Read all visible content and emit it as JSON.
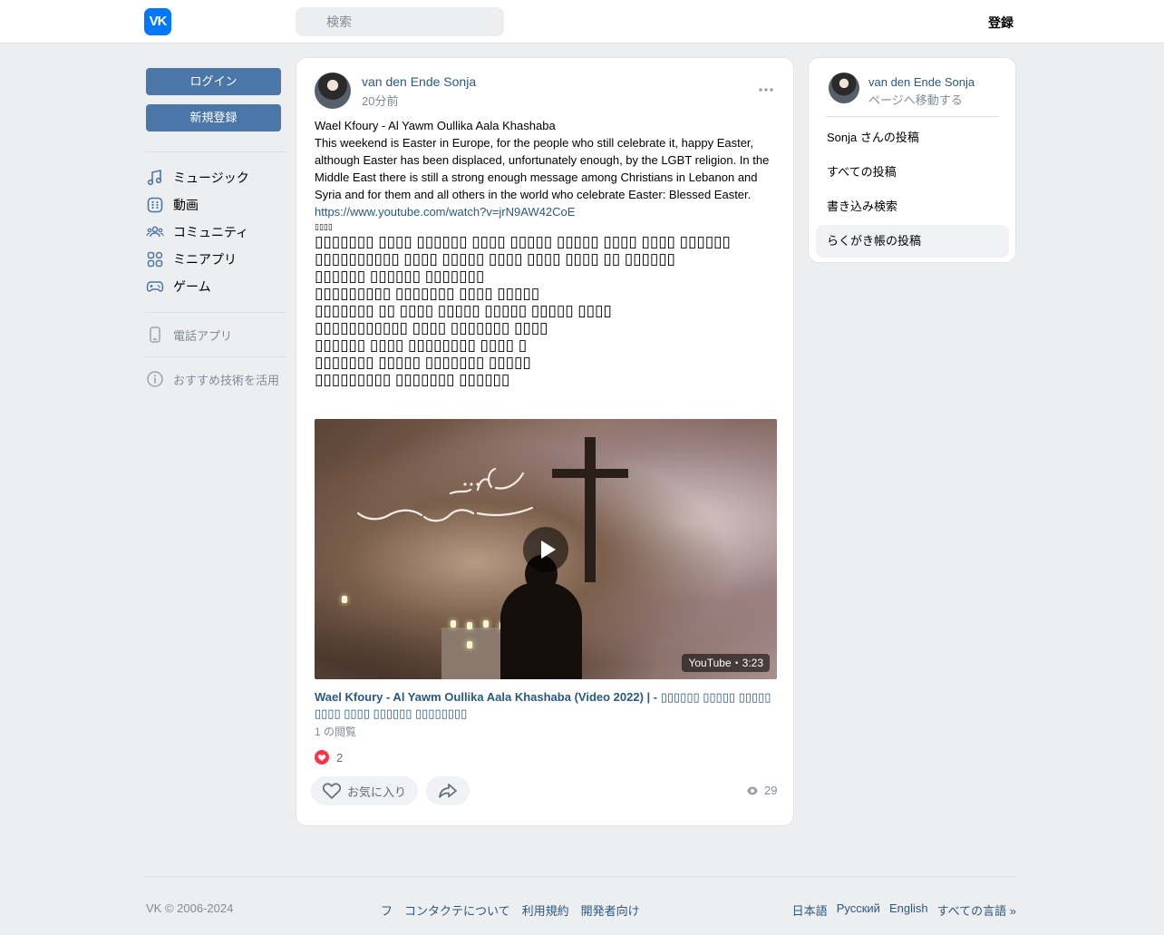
{
  "header": {
    "logo": "VK",
    "search_placeholder": "検索",
    "register_label": "登録"
  },
  "sidebar": {
    "login_label": "ログイン",
    "signup_label": "新規登録",
    "items": [
      {
        "label": "ミュージック",
        "icon": "music-icon"
      },
      {
        "label": "動画",
        "icon": "video-icon"
      },
      {
        "label": "コミュニティ",
        "icon": "community-icon"
      },
      {
        "label": "ミニアプリ",
        "icon": "mini-apps-icon"
      },
      {
        "label": "ゲーム",
        "icon": "gamepad-icon"
      }
    ],
    "phone_app_label": "電話アプリ",
    "recommended_label": "おすすめ技術を活用"
  },
  "post": {
    "author": "van den Ende Sonja",
    "time": "20分前",
    "text_title": "Wael Kfoury - Al Yawm Oullika Aala Khashaba",
    "text_body": "This weekend is Easter in Europe, for the people who still celebrate it, happy Easter, although Easter has been displaced, unfortunately enough, by the LGBT religion. In the Middle East there is still a strong enough message among Christians in Lebanon and Syria and for them and all others in the world who celebrate Easter: Blessed Easter.",
    "link": "https://www.youtube.com/watch?v=jrN9AW42CoE",
    "small_glyphs": "▯▯▯▯",
    "glyph_lines": [
      "▯▯▯▯▯▯▯ ▯▯▯▯ ▯▯▯▯▯▯ ▯▯▯▯ ▯▯▯▯▯ ▯▯▯▯▯ ▯▯▯▯ ▯▯▯▯ ▯▯▯▯▯▯",
      "▯▯▯▯▯▯▯▯▯▯ ▯▯▯▯ ▯▯▯▯▯ ▯▯▯▯ ▯▯▯▯ ▯▯▯▯ ▯▯ ▯▯▯▯▯▯",
      "▯▯▯▯▯▯ ▯▯▯▯▯▯ ▯▯▯▯▯▯▯",
      "▯▯▯▯▯▯▯▯▯ ▯▯▯▯▯▯▯ ▯▯▯▯ ▯▯▯▯▯",
      "▯▯▯▯▯▯▯ ▯▯ ▯▯▯▯ ▯▯▯▯▯ ▯▯▯▯▯ ▯▯▯▯▯ ▯▯▯▯",
      "▯▯▯▯▯▯▯▯▯▯▯ ▯▯▯▯ ▯▯▯▯▯▯▯ ▯▯▯▯",
      "▯▯▯▯▯▯ ▯▯▯▯ ▯▯▯▯▯▯▯▯ ▯▯▯▯ ▯",
      "▯▯▯▯▯▯▯ ▯▯▯▯▯ ▯▯▯▯▯▯▯ ▯▯▯▯▯",
      "▯▯▯▯▯▯▯▯▯ ▯▯▯▯▯▯▯ ▯▯▯▯▯▯"
    ],
    "video_duration": "YouTube・3:23",
    "video_title": "Wael Kfoury - Al Yawm Oullika Aala Khashaba (Video 2022) | - ▯▯▯▯▯▯ ▯▯▯▯▯ ▯▯▯▯▯ ▯▯▯▯ ▯▯▯▯ ▯▯▯▯▯▯ ▯▯▯▯▯▯▯▯",
    "video_views": "1 の閲覧",
    "likes_count": "2",
    "like_label": "お気に入り",
    "views_count": "29"
  },
  "right_panel": {
    "name": "van den Ende Sonja",
    "goto_label": "ページへ移動する",
    "items": [
      {
        "label": "Sonja さんの投稿",
        "active": false
      },
      {
        "label": "すべての投稿",
        "active": false
      },
      {
        "label": "書き込み検索",
        "active": false
      },
      {
        "label": "らくがき帳の投稿",
        "active": true
      }
    ]
  },
  "footer": {
    "copyright": "VK © 2006-2024",
    "links": [
      "フ",
      "コンタクテについて",
      "利用規約",
      "開発者向け"
    ],
    "languages": [
      "日本語",
      "Русский",
      "English",
      "すべての言語 »"
    ]
  },
  "colors": {
    "brand": "#0077ff",
    "button": "#4a76a8",
    "link": "#2a5885",
    "muted": "#818c99",
    "background": "#edeef0"
  }
}
